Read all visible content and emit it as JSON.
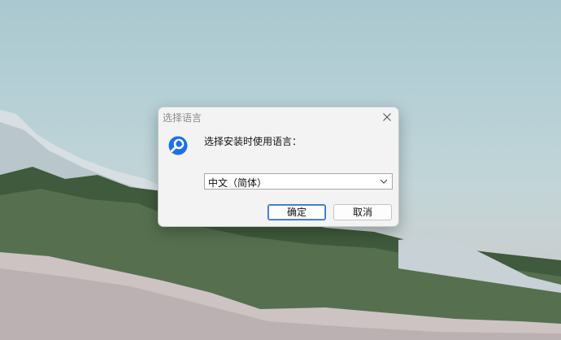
{
  "dialog": {
    "title": "选择语言",
    "prompt": "选择安装时使用语言：",
    "language_select": {
      "selected": "中文（简体）"
    },
    "ok_label": "确定",
    "cancel_label": "取消"
  },
  "icons": {
    "app": "app-logo-icon",
    "close": "close-icon",
    "dropdown": "chevron-down-icon"
  },
  "colors": {
    "accent": "#2f6fd0",
    "app_icon": "#1e6fe8",
    "dialog_bg": "#f3f3f3"
  }
}
